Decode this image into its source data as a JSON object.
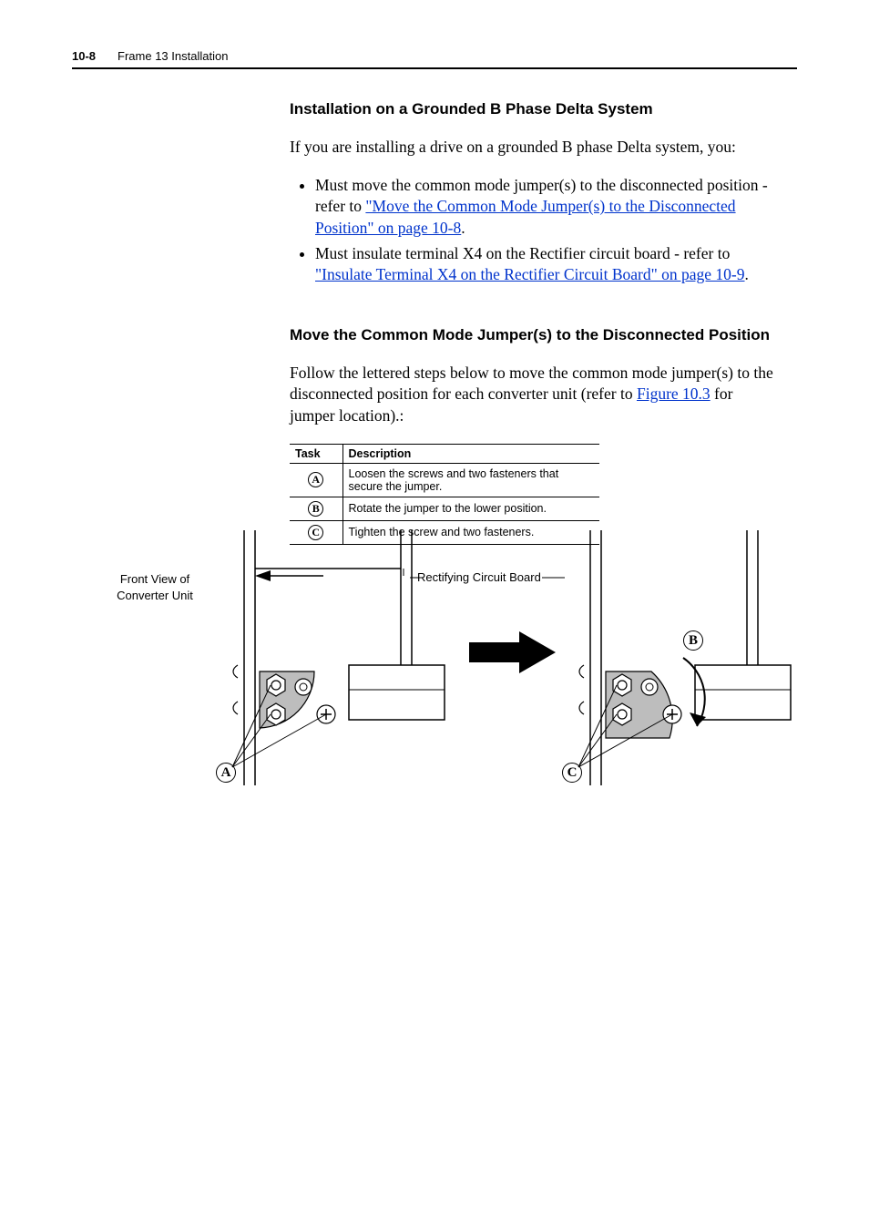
{
  "header": {
    "page_number": "10-8",
    "chapter_title": "Frame 13 Installation"
  },
  "section1": {
    "heading": "Installation on a Grounded B Phase Delta System",
    "intro": "If you are installing a drive on a grounded B phase Delta system, you:",
    "bullets": [
      {
        "pre": "Must move the common mode jumper(s) to the disconnected position - refer to ",
        "link": "\"Move the Common Mode Jumper(s) to the Disconnected Position\" on page 10-8",
        "post": "."
      },
      {
        "pre": "Must insulate terminal X4 on the Rectifier circuit board - refer to ",
        "link": "\"Insulate Terminal X4 on the Rectifier Circuit Board\" on page 10-9",
        "post": "."
      }
    ]
  },
  "section2": {
    "heading": "Move the Common Mode Jumper(s) to the Disconnected Position",
    "intro_pre": "Follow the lettered steps below to move the common mode jumper(s) to the disconnected position for each converter unit (refer to ",
    "intro_link": "Figure 10.3",
    "intro_post": " for jumper location).:",
    "table": {
      "headers": [
        "Task",
        "Description"
      ],
      "rows": [
        {
          "task": "A",
          "desc": "Loosen the screws and two fasteners that secure the jumper."
        },
        {
          "task": "B",
          "desc": "Rotate the jumper to the lower position."
        },
        {
          "task": "C",
          "desc": "Tighten the screw and two fasteners."
        }
      ]
    }
  },
  "figure": {
    "side_label_line1": "Front View of",
    "side_label_line2": "Converter Unit",
    "callout_label": "Rectifying Circuit Board",
    "marker_a": "A",
    "marker_b": "B",
    "marker_c": "C"
  }
}
